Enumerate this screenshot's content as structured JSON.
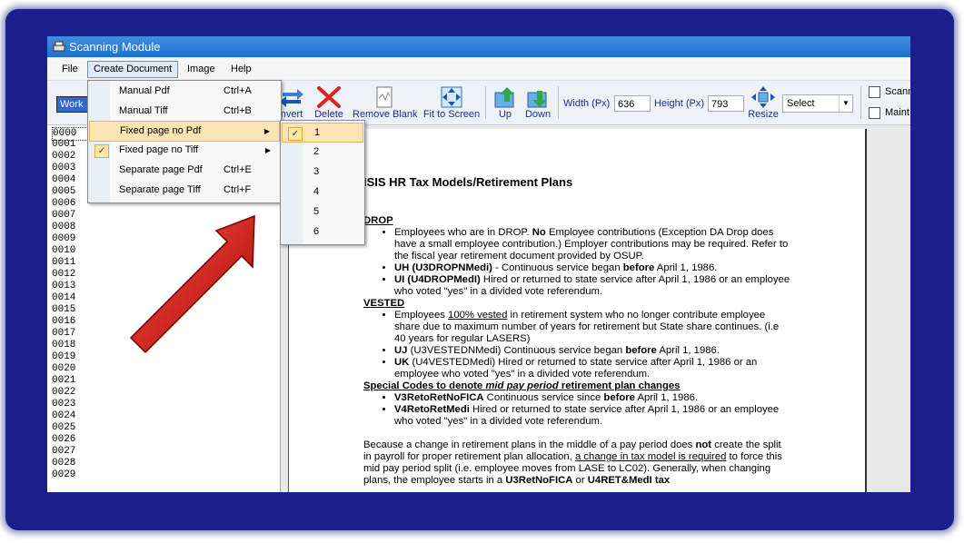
{
  "window": {
    "title": "Scanning Module"
  },
  "menubar": {
    "items": [
      "File",
      "Create Document",
      "Image",
      "Help"
    ]
  },
  "toolbar": {
    "work_value": "Work",
    "buttons": {
      "convert": "nvert",
      "delete": "Delete",
      "remove_blank": "Remove Blank",
      "fit_to_screen": "Fit to Screen",
      "up": "Up",
      "down": "Down",
      "resize": "Resize"
    },
    "width_label": "Width (Px)",
    "width_value": "636",
    "height_label": "Height (Px)",
    "height_value": "793",
    "select_value": "Select",
    "checkboxes": [
      "Scann",
      "Maint"
    ]
  },
  "create_document_menu": [
    {
      "label": "Manual Pdf",
      "shortcut": "Ctrl+A"
    },
    {
      "label": "Manual Tiff",
      "shortcut": "Ctrl+B"
    },
    {
      "label": "Fixed page no Pdf",
      "shortcut": ""
    },
    {
      "label": "Fixed page no Tiff",
      "shortcut": ""
    },
    {
      "label": "Separate page Pdf",
      "shortcut": "Ctrl+E"
    },
    {
      "label": "Separate page Tiff",
      "shortcut": "Ctrl+F"
    }
  ],
  "fixed_page_submenu": [
    "1",
    "2",
    "3",
    "4",
    "5",
    "6"
  ],
  "page_list": [
    "0000",
    "0001",
    "0002",
    "0003",
    "0004",
    "0005",
    "0006",
    "0007",
    "0008",
    "0009",
    "0010",
    "0011",
    "0012",
    "0013",
    "0014",
    "0015",
    "0016",
    "0017",
    "0018",
    "0019",
    "0020",
    "0021",
    "0022",
    "0023",
    "0024",
    "0025",
    "0026",
    "0027",
    "0028",
    "0029"
  ],
  "document": {
    "title": "ISIS HR Tax Models/Retirement Plans",
    "drop_heading": "DROP",
    "drop_1a": "Employees who are in DROP.  ",
    "drop_1b": "No",
    "drop_1c": " Employee contributions (Exception DA Drop does have a small employee contribution.)  Employer contributions may be required.  Refer to the fiscal year retirement document provided by OSUP.",
    "drop_2a": "UH (U3DROPNMedi)",
    "drop_2b": " - Continuous service began ",
    "drop_2c": "before",
    "drop_2d": " April 1, 1986.",
    "drop_3a": "UI (U4DROPMedI)",
    "drop_3b": " Hired or returned to state service after April 1, 1986 or an employee who voted \"yes\" in a divided vote referendum.",
    "vested_heading": "VESTED",
    "vested_1a": "Employees ",
    "vested_1b": "100% vested",
    "vested_1c": " in retirement system who no longer contribute employee share due to maximum number of years for retirement but State share continues. (i.e  40 years for regular LASERS)",
    "vested_2a": "UJ",
    "vested_2b": " (U3VESTEDNMedi) Continuous service began ",
    "vested_2c": "before",
    "vested_2d": " April 1, 1986.",
    "vested_3a": "UK",
    "vested_3b": " (U4VESTEDMedi) Hired or returned to state service after April 1, 1986 or an employee who voted \"yes\" in a divided vote referendum.",
    "special_heading_a": "Special Codes to denote ",
    "special_heading_b": "mid pay period",
    "special_heading_c": " retirement plan changes",
    "special_1a": "V3RetoRetNoFICA",
    "special_1b": " Continuous service since ",
    "special_1c": "before",
    "special_1d": " April 1, 1986.",
    "special_2a": "V4RetoRetMedi",
    "special_2b": " Hired or returned to state service after April 1, 1986 or an employee who voted \"yes\" in a divided vote referendum.",
    "para_a": "Because a change in retirement plans in the middle of a pay period does ",
    "para_b": "not",
    "para_c": " create the split in payroll for proper retirement plan allocation, ",
    "para_d": "a change in tax model is required",
    "para_e": " to force this mid pay period split (i.e. employee moves from LASE to LC02). Generally, when changing plans, the employee starts in a ",
    "para_f": "U3RetNoFICA",
    "para_g": " or ",
    "para_h": "U4RET&MedI tax"
  },
  "colors": {
    "frame": "#1a1f8c",
    "titlebar": "#2f7fd8",
    "highlight": "#fbe4b4",
    "arrow": "#d01010"
  }
}
